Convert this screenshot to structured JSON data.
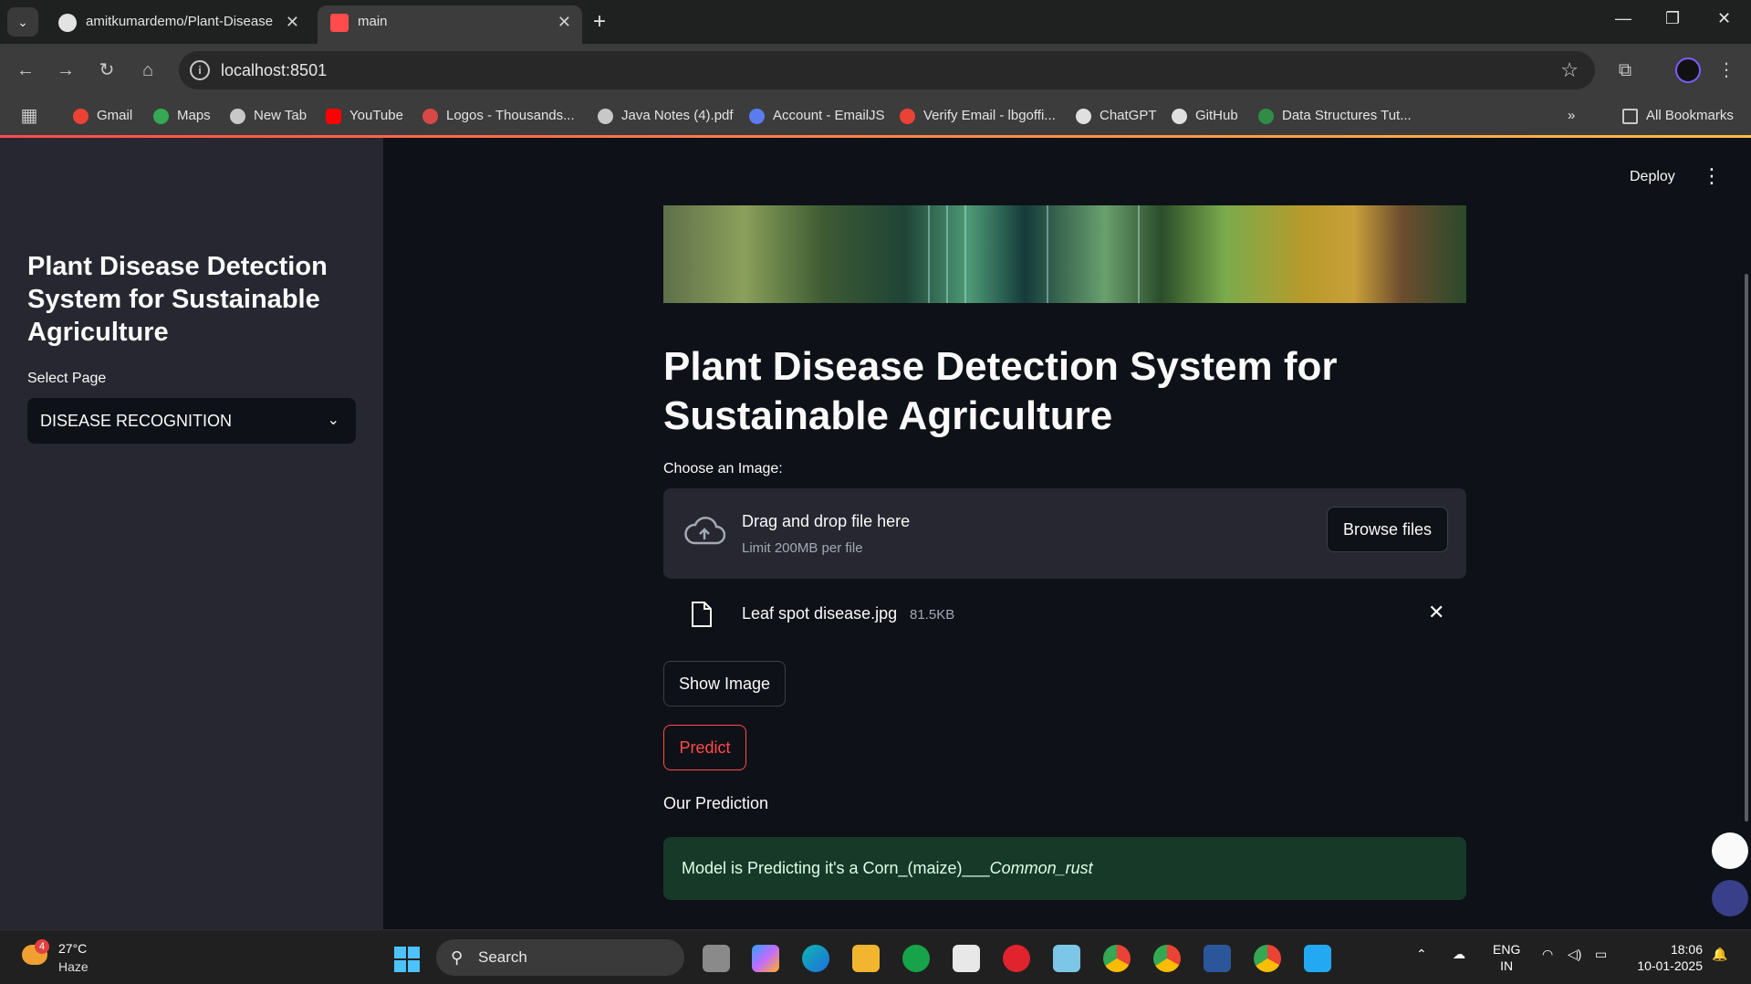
{
  "browser": {
    "tabs": [
      {
        "title": "amitkumardemo/Plant-Disease"
      },
      {
        "title": "main"
      }
    ],
    "new_tab_symbol": "+",
    "address": "localhost:8501",
    "bookmarks": [
      {
        "label": "Gmail",
        "color": "#ea4335"
      },
      {
        "label": "Maps",
        "color": "#34a853"
      },
      {
        "label": "New Tab",
        "color": "#c8c8c8"
      },
      {
        "label": "YouTube",
        "color": "#ff0000"
      },
      {
        "label": "Logos - Thousands...",
        "color": "#d94848"
      },
      {
        "label": "Java Notes (4).pdf",
        "color": "#c8c8c8"
      },
      {
        "label": "Account - EmailJS",
        "color": "#5b7cf0"
      },
      {
        "label": "Verify Email - lbgoffi...",
        "color": "#ea4335"
      },
      {
        "label": "ChatGPT",
        "color": "#e0e0e0"
      },
      {
        "label": "GitHub",
        "color": "#e0e0e0"
      },
      {
        "label": "Data Structures Tut...",
        "color": "#2f8d46"
      }
    ],
    "all_bookmarks": "All Bookmarks"
  },
  "sidebar": {
    "title": "Plant Disease Detection System for Sustainable Agriculture",
    "select_label": "Select Page",
    "selected_page": "DISEASE RECOGNITION"
  },
  "header": {
    "deploy_label": "Deploy"
  },
  "main": {
    "title": "Plant Disease Detection System for Sustainable Agriculture",
    "uploader_label": "Choose an Image:",
    "dropzone_text": "Drag and drop file here",
    "dropzone_limit": "Limit 200MB per file",
    "browse_label": "Browse files",
    "file_name": "Leaf spot disease.jpg",
    "file_size": "81.5KB",
    "show_image_label": "Show Image",
    "predict_label": "Predict",
    "prediction_heading": "Our Prediction",
    "prediction_prefix": "Model is Predicting it's a Corn_(maize)___",
    "prediction_class": "Common_rust"
  },
  "taskbar": {
    "weather_temp": "27°C",
    "weather_desc": "Haze",
    "weather_badge": "4",
    "search_label": "Search",
    "lang_line1": "ENG",
    "lang_line2": "IN",
    "time": "18:06",
    "date": "10-01-2025"
  },
  "colors": {
    "accent_red": "#ff4b4b",
    "success_bg": "#173928",
    "sidebar_bg": "#262730",
    "main_bg": "#0e1117"
  }
}
